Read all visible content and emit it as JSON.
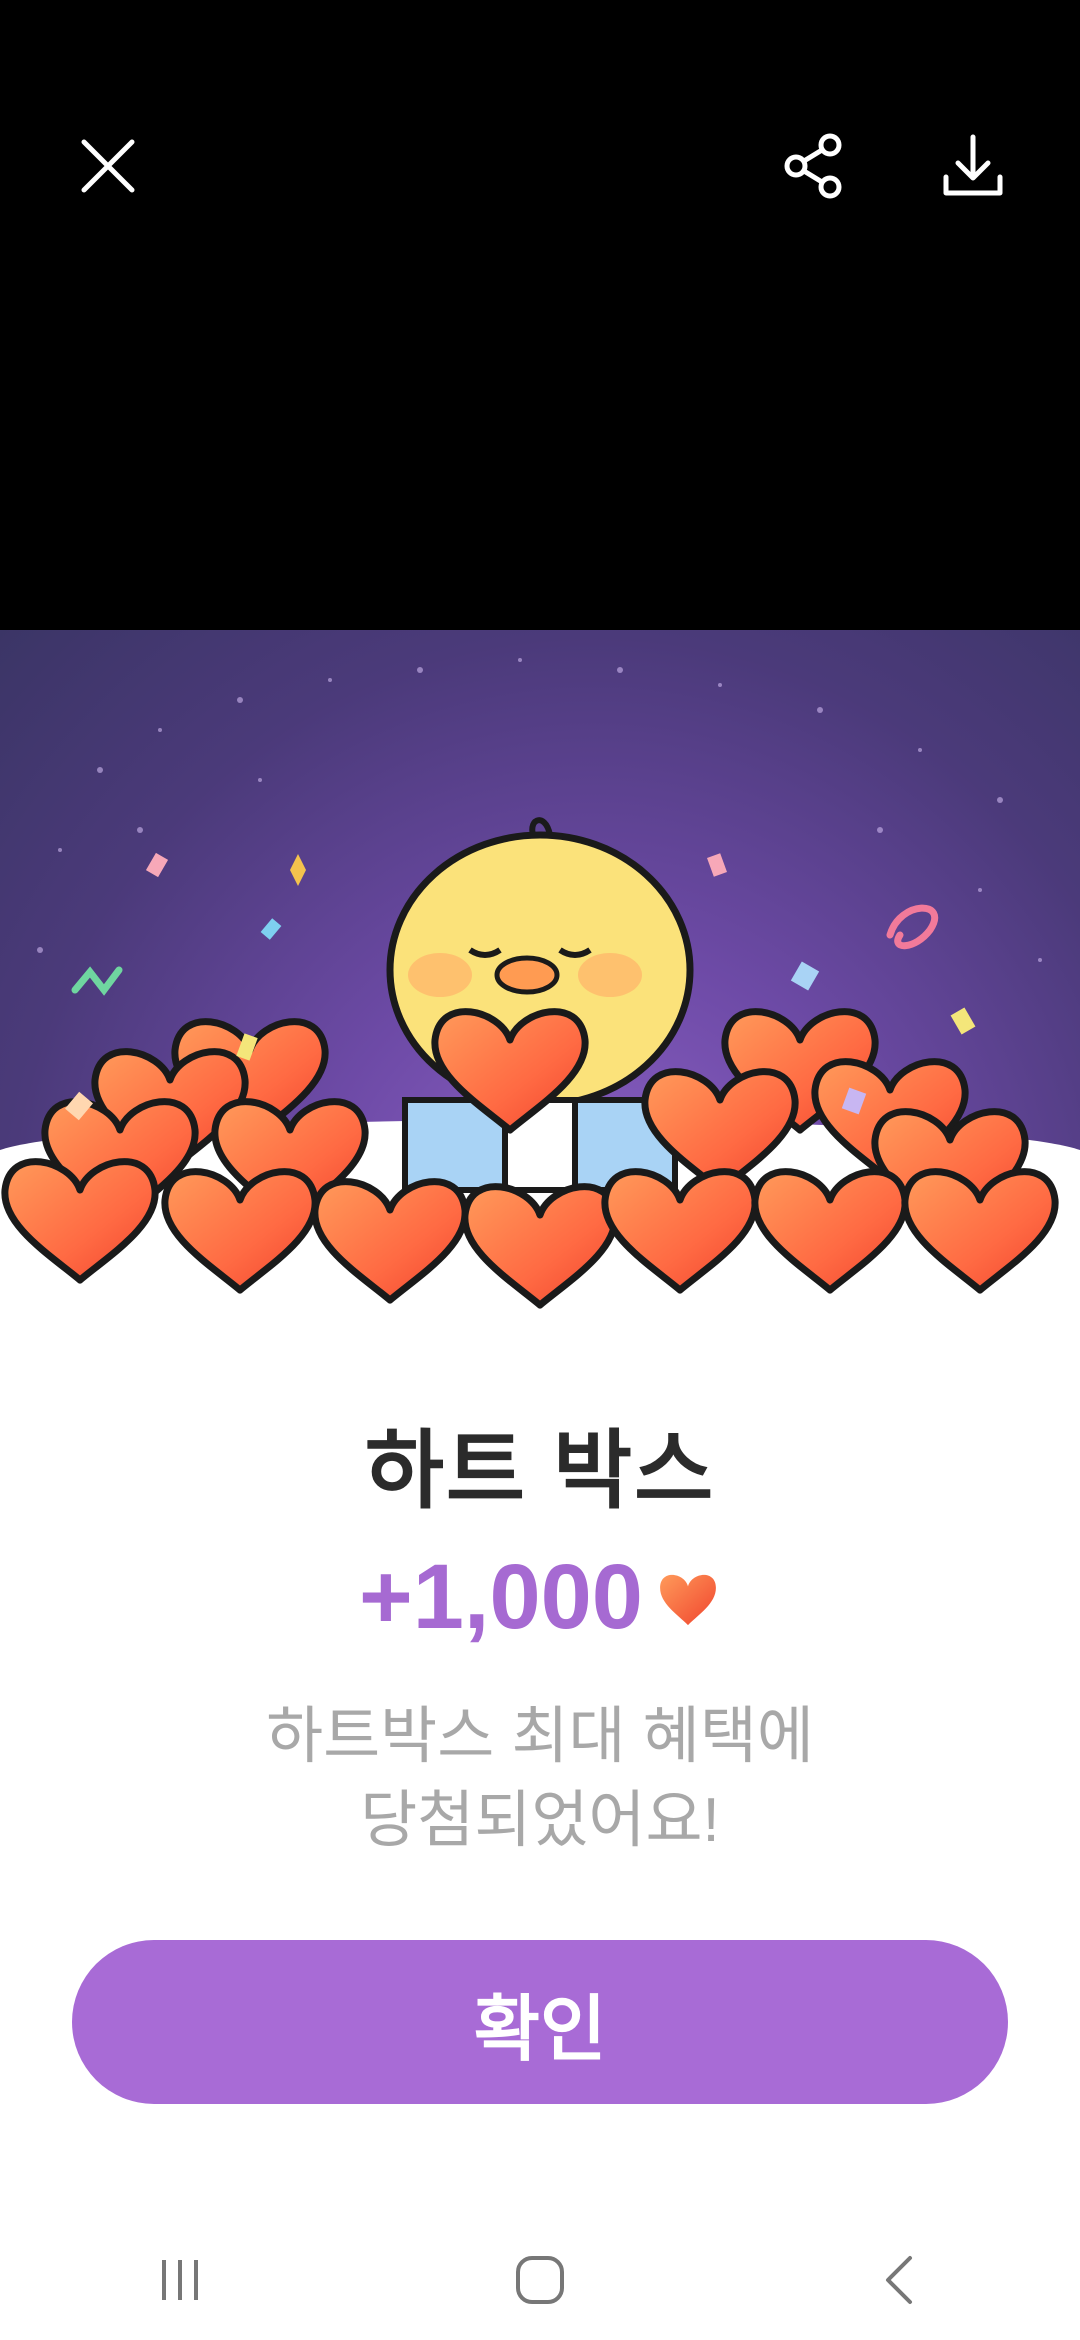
{
  "header": {
    "close_icon": "close-icon",
    "share_icon": "share-icon",
    "download_icon": "download-icon"
  },
  "reward": {
    "title": "하트 박스",
    "amount": "+1,000",
    "message_line1": "하트박스 최대 혜택에",
    "message_line2": "당첨되었어요!"
  },
  "actions": {
    "confirm_label": "확인"
  },
  "nav": {
    "recents_icon": "recents-icon",
    "home_icon": "home-icon",
    "back_icon": "back-icon"
  },
  "colors": {
    "accent": "#a86bd6",
    "amount_text": "#a66ad2",
    "heart": "#ff5a3a"
  }
}
